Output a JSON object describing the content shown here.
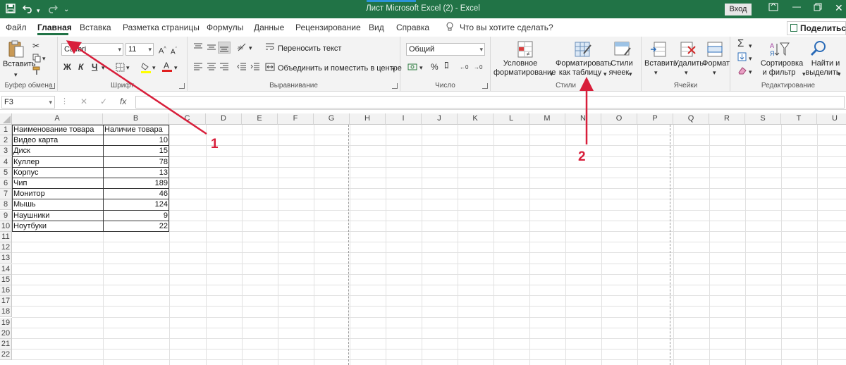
{
  "window": {
    "title": "Лист Microsoft Excel (2)  -  Excel",
    "signin": "Вход"
  },
  "tabs": [
    "Файл",
    "Главная",
    "Вставка",
    "Разметка страницы",
    "Формулы",
    "Данные",
    "Рецензирование",
    "Вид",
    "Справка"
  ],
  "active_tab": "Главная",
  "tell_me": "Что вы хотите сделать?",
  "share": "Поделиться",
  "ribbon": {
    "clipboard": {
      "label": "Буфер обмена",
      "paste": "Вставить"
    },
    "font": {
      "label": "Шрифт",
      "name": "Calibri",
      "size": "11",
      "bold": "Ж",
      "italic": "К",
      "underline": "Ч"
    },
    "alignment": {
      "label": "Выравнивание",
      "wrap": "Переносить текст",
      "merge": "Объединить и поместить в центре"
    },
    "number": {
      "label": "Число",
      "format": "Общий"
    },
    "styles": {
      "label": "Стили",
      "conditional_1": "Условное",
      "conditional_2": "форматирование",
      "table_1": "Форматировать",
      "table_2": "как таблицу",
      "cell_styles_1": "Стили",
      "cell_styles_2": "ячеек"
    },
    "cells": {
      "label": "Ячейки",
      "insert": "Вставить",
      "delete": "Удалить",
      "format": "Формат"
    },
    "editing": {
      "label": "Редактирование",
      "sort_1": "Сортировка",
      "sort_2": "и фильтр",
      "find_1": "Найти и",
      "find_2": "выделить"
    }
  },
  "formula_bar": {
    "name_box": "F3",
    "fx": "fx",
    "value": ""
  },
  "columns": [
    "A",
    "B",
    "C",
    "D",
    "E",
    "F",
    "G",
    "H",
    "I",
    "J",
    "K",
    "L",
    "M",
    "N",
    "O",
    "P",
    "Q",
    "R",
    "S",
    "T",
    "U"
  ],
  "rows": [
    "1",
    "2",
    "3",
    "4",
    "5",
    "6",
    "7",
    "8",
    "9",
    "10",
    "11",
    "12",
    "13",
    "14",
    "15",
    "16",
    "17",
    "18",
    "19",
    "20",
    "21",
    "22"
  ],
  "table": {
    "headers": [
      "Наименование товара",
      "Наличие товара"
    ],
    "rows": [
      [
        "Видео карта",
        "10"
      ],
      [
        "Диск",
        "15"
      ],
      [
        "Куллер",
        "78"
      ],
      [
        "Корпус",
        "13"
      ],
      [
        "Чип",
        "189"
      ],
      [
        "Монитор",
        "46"
      ],
      [
        "Мышь",
        "124"
      ],
      [
        "Наушники",
        "9"
      ],
      [
        "Ноутбуки",
        "22"
      ]
    ]
  },
  "annotations": [
    "1",
    "2"
  ],
  "colors": {
    "excel_green": "#217346",
    "annotation_red": "#d81e3a"
  }
}
